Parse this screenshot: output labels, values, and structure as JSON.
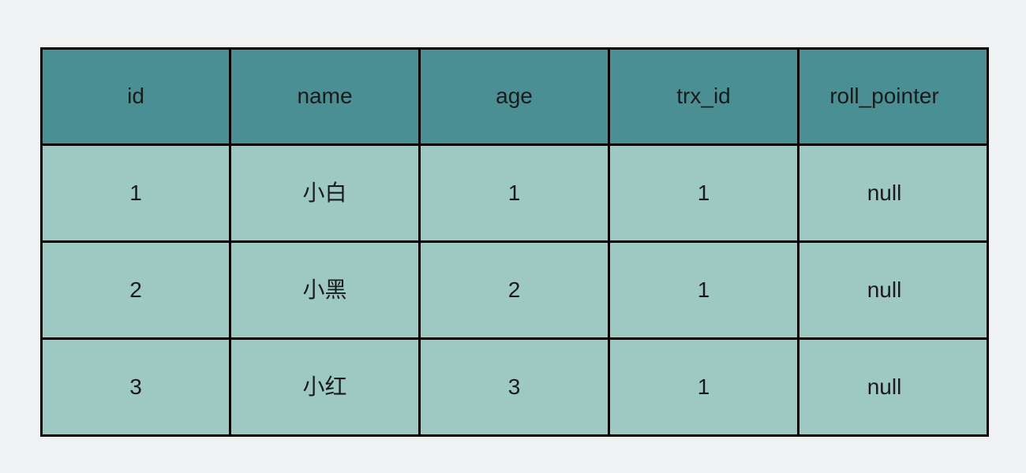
{
  "table": {
    "name": "user-record-table",
    "columns": [
      {
        "key": "id",
        "label": "id"
      },
      {
        "key": "name",
        "label": "name"
      },
      {
        "key": "age",
        "label": "age"
      },
      {
        "key": "trx_id",
        "label": "trx_id"
      },
      {
        "key": "roll_pointer",
        "label": "roll_pointer"
      }
    ],
    "rows": [
      {
        "id": "1",
        "name": "小白",
        "age": "1",
        "trx_id": "1",
        "roll_pointer": "null"
      },
      {
        "id": "2",
        "name": "小黑",
        "age": "2",
        "trx_id": "1",
        "roll_pointer": "null"
      },
      {
        "id": "3",
        "name": "小红",
        "age": "3",
        "trx_id": "1",
        "roll_pointer": "null"
      }
    ]
  },
  "colors": {
    "page_background": "#eff1f3",
    "header_fill": "#4a8f94",
    "body_fill": "#9ec9c3",
    "border": "#000000",
    "text": "#1a1a1a"
  }
}
